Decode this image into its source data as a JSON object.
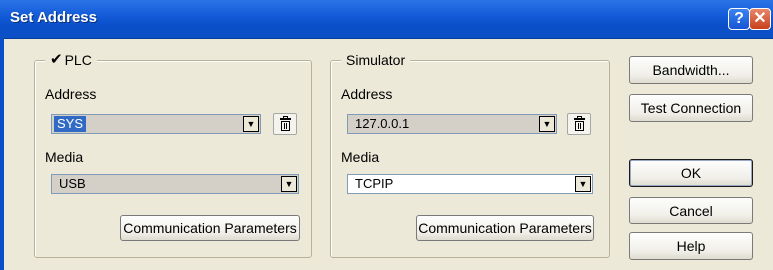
{
  "window": {
    "title": "Set Address",
    "help_glyph": "?",
    "close_glyph": "✕"
  },
  "plc": {
    "check_glyph": "✔",
    "legend": "PLC",
    "address_label": "Address",
    "address_value": "SYS",
    "media_label": "Media",
    "media_value": "USB",
    "comm_params_label": "Communication  Parameters"
  },
  "simulator": {
    "legend": "Simulator",
    "address_label": "Address",
    "address_value": "127.0.0.1",
    "media_label": "Media",
    "media_value": "TCPIP",
    "comm_params_label": "Communication  Parameters"
  },
  "buttons": {
    "bandwidth": "Bandwidth...",
    "test_connection": "Test Connection",
    "ok": "OK",
    "cancel": "Cancel",
    "help": "Help"
  },
  "dropdown_arrow": "▼",
  "colors": {
    "titlebar": "#0a4fc8",
    "selection": "#316ac5",
    "dialog_bg": "#ece9d8"
  }
}
